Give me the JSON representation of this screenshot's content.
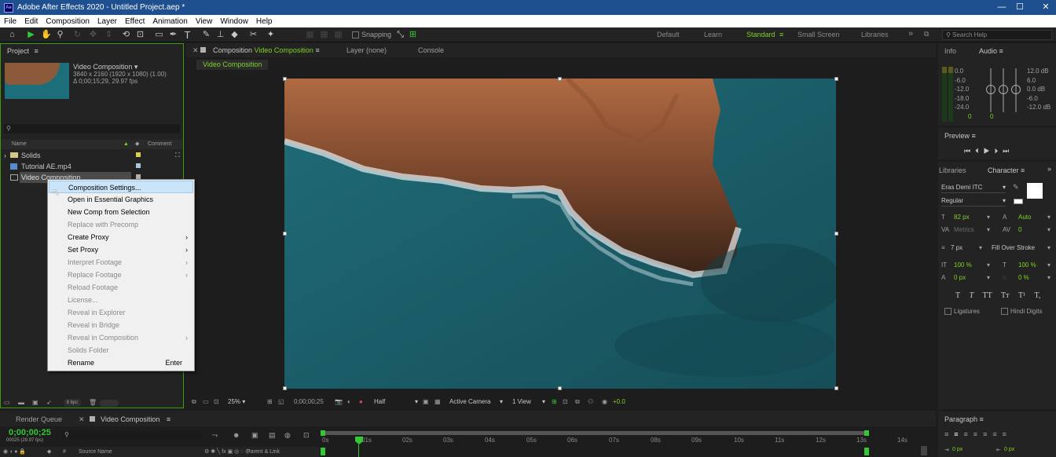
{
  "app": {
    "title": "Adobe After Effects 2020 - Untitled Project.aep *",
    "logo": "Ae"
  },
  "menu": [
    "File",
    "Edit",
    "Composition",
    "Layer",
    "Effect",
    "Animation",
    "View",
    "Window",
    "Help"
  ],
  "toolbar": {
    "snapping": "Snapping",
    "workspaces": [
      "Default",
      "Learn",
      "Standard",
      "Small Screen",
      "Libraries"
    ],
    "active_workspace": "Standard",
    "search_placeholder": "Search Help"
  },
  "project": {
    "tab": "Project",
    "comp_name": "Video Composition ▾",
    "comp_size": "3840 x 2160  (1920 x 1080) (1.00)",
    "comp_duration": "Δ 0;00;15;29, 29.97 fps",
    "col_name": "Name",
    "col_comment": "Comment",
    "items": [
      "Solids",
      "Tutorial AE.mp4",
      "Video Composition"
    ],
    "bpc": "8 bpc"
  },
  "context_menu": {
    "items": [
      {
        "label": "Composition Settings...",
        "enabled": true,
        "selected": true
      },
      {
        "label": "Open in Essential Graphics",
        "enabled": true
      },
      {
        "label": "New Comp from Selection",
        "enabled": true
      },
      {
        "label": "Replace with Precomp",
        "enabled": false
      },
      {
        "label": "Create Proxy",
        "enabled": true,
        "submenu": true
      },
      {
        "label": "Set Proxy",
        "enabled": true,
        "submenu": true
      },
      {
        "label": "Interpret Footage",
        "enabled": false,
        "submenu": true
      },
      {
        "label": "Replace Footage",
        "enabled": false,
        "submenu": true
      },
      {
        "label": "Reload Footage",
        "enabled": false
      },
      {
        "label": "License...",
        "enabled": false
      },
      {
        "label": "Reveal in Explorer",
        "enabled": false
      },
      {
        "label": "Reveal in Bridge",
        "enabled": false
      },
      {
        "label": "Reveal in Composition",
        "enabled": false,
        "submenu": true
      },
      {
        "label": "Solids Folder",
        "enabled": false
      },
      {
        "label": "Rename",
        "enabled": true,
        "shortcut": "Enter"
      }
    ]
  },
  "viewer": {
    "tab_prefix": "Composition",
    "tab_name": "Video Composition",
    "layer_tab": "Layer (none)",
    "console_tab": "Console",
    "breadcrumb": "Video Composition",
    "zoom": "25%",
    "timecode": "0;00;00;25",
    "resolution": "Half",
    "camera": "Active Camera",
    "views": "1 View",
    "exposure": "+0.0"
  },
  "info_panel": {
    "info_tab": "Info",
    "audio_tab": "Audio",
    "db_left": [
      "0.0",
      "-6.0",
      "-12.0",
      "-18.0",
      "-24.0"
    ],
    "db_right": [
      "12.0 dB",
      "6.0",
      "0.0 dB",
      "-6.0",
      "-12.0 dB"
    ],
    "meter_l": "0",
    "meter_r": "0"
  },
  "preview": {
    "tab": "Preview"
  },
  "character": {
    "libraries_tab": "Libraries",
    "character_tab": "Character",
    "font": "Eras Demi ITC",
    "style": "Regular",
    "size": "82 px",
    "leading": "Auto",
    "kerning": "Metrics",
    "tracking": "0",
    "stroke_width": "7 px",
    "stroke_type": "Fill Over Stroke",
    "vscale": "100 %",
    "hscale": "100 %",
    "baseline": "0 px",
    "tsume": "0 %",
    "styles": [
      "T",
      "T",
      "TT",
      "Tт",
      "T¹",
      "T,"
    ],
    "ligatures": "Ligatures",
    "hindi_digits": "Hindi Digits"
  },
  "paragraph": {
    "tab": "Paragraph",
    "indent_left": "0 px",
    "indent_right": "0 px"
  },
  "timeline": {
    "render_queue": "Render Queue",
    "comp_tab": "Video Composition",
    "timecode": "0;00;00;25",
    "fps": "00025 (29.97 fps)",
    "source_name": "Source Name",
    "parent_link": "Parent & Link",
    "ticks": [
      "0s",
      "01s",
      "02s",
      "03s",
      "04s",
      "05s",
      "06s",
      "07s",
      "08s",
      "09s",
      "10s",
      "11s",
      "12s",
      "13s",
      "14s"
    ]
  }
}
